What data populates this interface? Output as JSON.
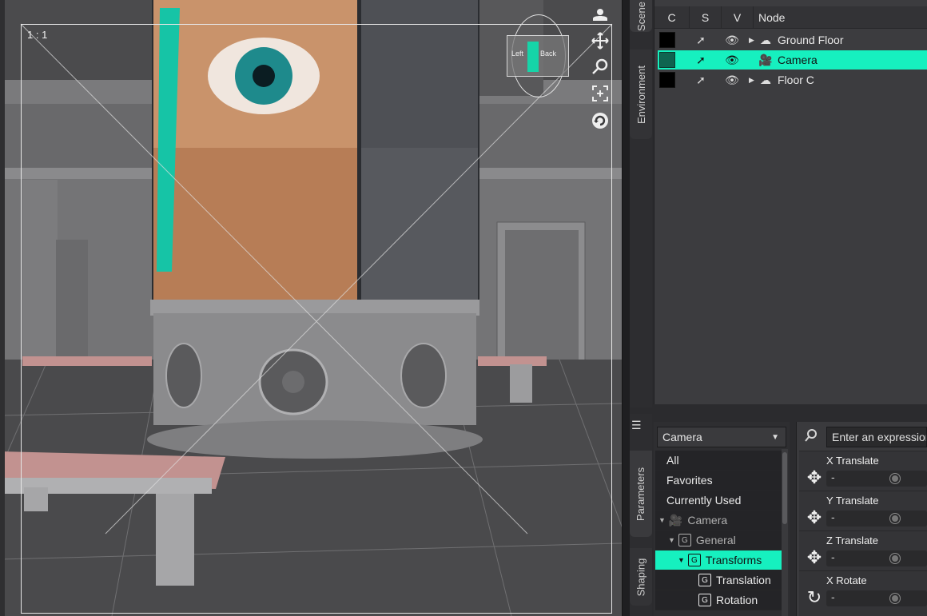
{
  "viewport": {
    "aspect_label": "1 : 1",
    "tools": [
      "camera-orbit-icon",
      "pan-icon",
      "zoom-icon",
      "frame-icon",
      "rotate-icon"
    ],
    "cube": {
      "left_label": "Left",
      "back_label": "Back"
    }
  },
  "scene_tabs": [
    "Scene",
    "Environment"
  ],
  "scene": {
    "columns": {
      "c": "C",
      "s": "S",
      "v": "V",
      "node": "Node"
    },
    "rows": [
      {
        "label": "Ground Floor",
        "icon": "group-icon",
        "expandable": true,
        "selected": false
      },
      {
        "label": "Camera",
        "icon": "camera-icon",
        "expandable": false,
        "selected": true
      },
      {
        "label": "Floor C",
        "icon": "group-icon",
        "expandable": true,
        "selected": false
      }
    ]
  },
  "lower_tabs": [
    "Parameters",
    "Shaping"
  ],
  "parameters": {
    "node_select": "Camera",
    "search_placeholder": "Enter an expression",
    "tree": [
      {
        "label": "All"
      },
      {
        "label": "Favorites"
      },
      {
        "label": "Currently Used"
      },
      {
        "label": "Camera"
      },
      {
        "label": "General"
      },
      {
        "label": "Transforms"
      },
      {
        "label": "Translation"
      },
      {
        "label": "Rotation"
      }
    ],
    "props": [
      {
        "label": "X Translate",
        "icon": "move-icon",
        "value": "-"
      },
      {
        "label": "Y Translate",
        "icon": "move-icon",
        "value": "-"
      },
      {
        "label": "Z Translate",
        "icon": "move-icon",
        "value": "-"
      },
      {
        "label": "X Rotate",
        "icon": "rotate-icon",
        "value": "-"
      }
    ]
  },
  "colors": {
    "accent": "#16f0bf",
    "panel": "#3c3c3f",
    "dark": "#2b2b2e"
  }
}
